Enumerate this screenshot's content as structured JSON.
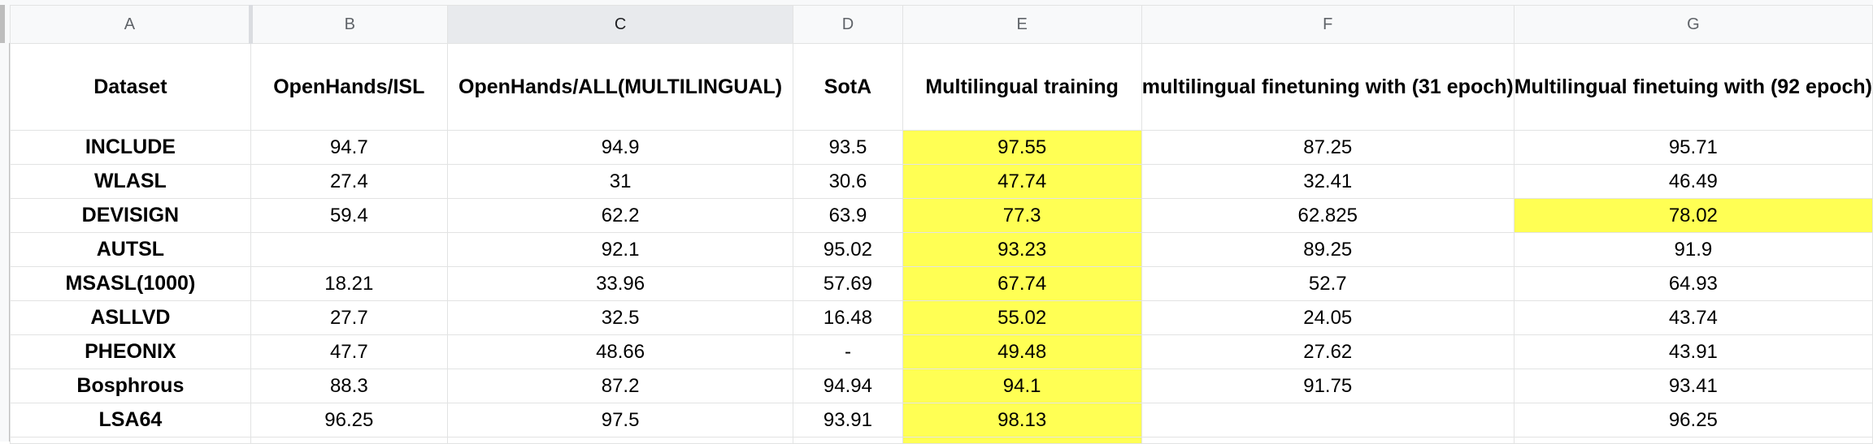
{
  "columns": [
    "A",
    "B",
    "C",
    "D",
    "E",
    "F",
    "G"
  ],
  "headers": [
    "Dataset",
    "OpenHands/ISL",
    "OpenHands/ALL(MULTILINGUAL)",
    "SotA",
    "Multilingual training",
    "multilingual finetuning with (31 epoch)",
    "Multilingual finetuing with (92 epoch)"
  ],
  "rows": [
    [
      "INCLUDE",
      "94.7",
      "94.9",
      "93.5",
      "97.55",
      "87.25",
      "95.71"
    ],
    [
      "WLASL",
      "27.4",
      "31",
      "30.6",
      "47.74",
      "32.41",
      "46.49"
    ],
    [
      "DEVISIGN",
      "59.4",
      "62.2",
      "63.9",
      "77.3",
      "62.825",
      "78.02"
    ],
    [
      "AUTSL",
      "",
      "92.1",
      "95.02",
      "93.23",
      "89.25",
      "91.9"
    ],
    [
      "MSASL(1000)",
      "18.21",
      "33.96",
      "57.69",
      "67.74",
      "52.7",
      "64.93"
    ],
    [
      "ASLLVD",
      "27.7",
      "32.5",
      "16.48",
      "55.02",
      "24.05",
      "43.74"
    ],
    [
      "PHEONIX",
      "47.7",
      "48.66",
      "-",
      "49.48",
      "27.62",
      "43.91"
    ],
    [
      "Bosphrous",
      "88.3",
      "87.2",
      "94.94",
      "94.1",
      "91.75",
      "93.41"
    ],
    [
      "LSA64",
      "96.25",
      "97.5",
      "93.91",
      "98.13",
      "",
      "96.25"
    ]
  ],
  "highlight_color": "#ffff54",
  "selection_color": "#1a73e8"
}
